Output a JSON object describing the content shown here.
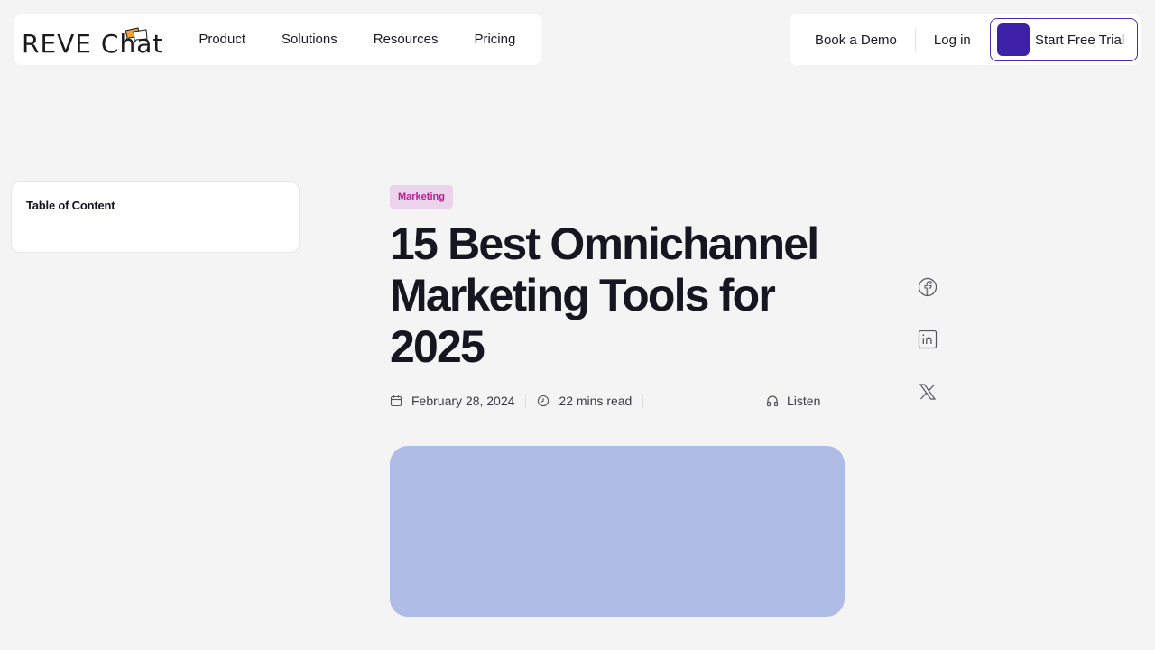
{
  "header": {
    "logo_text": "REVE Chat",
    "nav": [
      "Product",
      "Solutions",
      "Resources",
      "Pricing"
    ],
    "book_demo": "Book a Demo",
    "login": "Log in",
    "start_trial": "Start Free Trial",
    "accent_color": "#3d1fa8"
  },
  "toc": {
    "title": "Table of Content"
  },
  "article": {
    "tag": "Marketing",
    "title": "15 Best Omnichannel Marketing Tools for 2025",
    "date": "February 28, 2024",
    "read_time": "22 mins read",
    "listen_label": "Listen"
  },
  "share": {
    "icons": [
      "facebook-icon",
      "linkedin-icon",
      "x-icon"
    ]
  }
}
